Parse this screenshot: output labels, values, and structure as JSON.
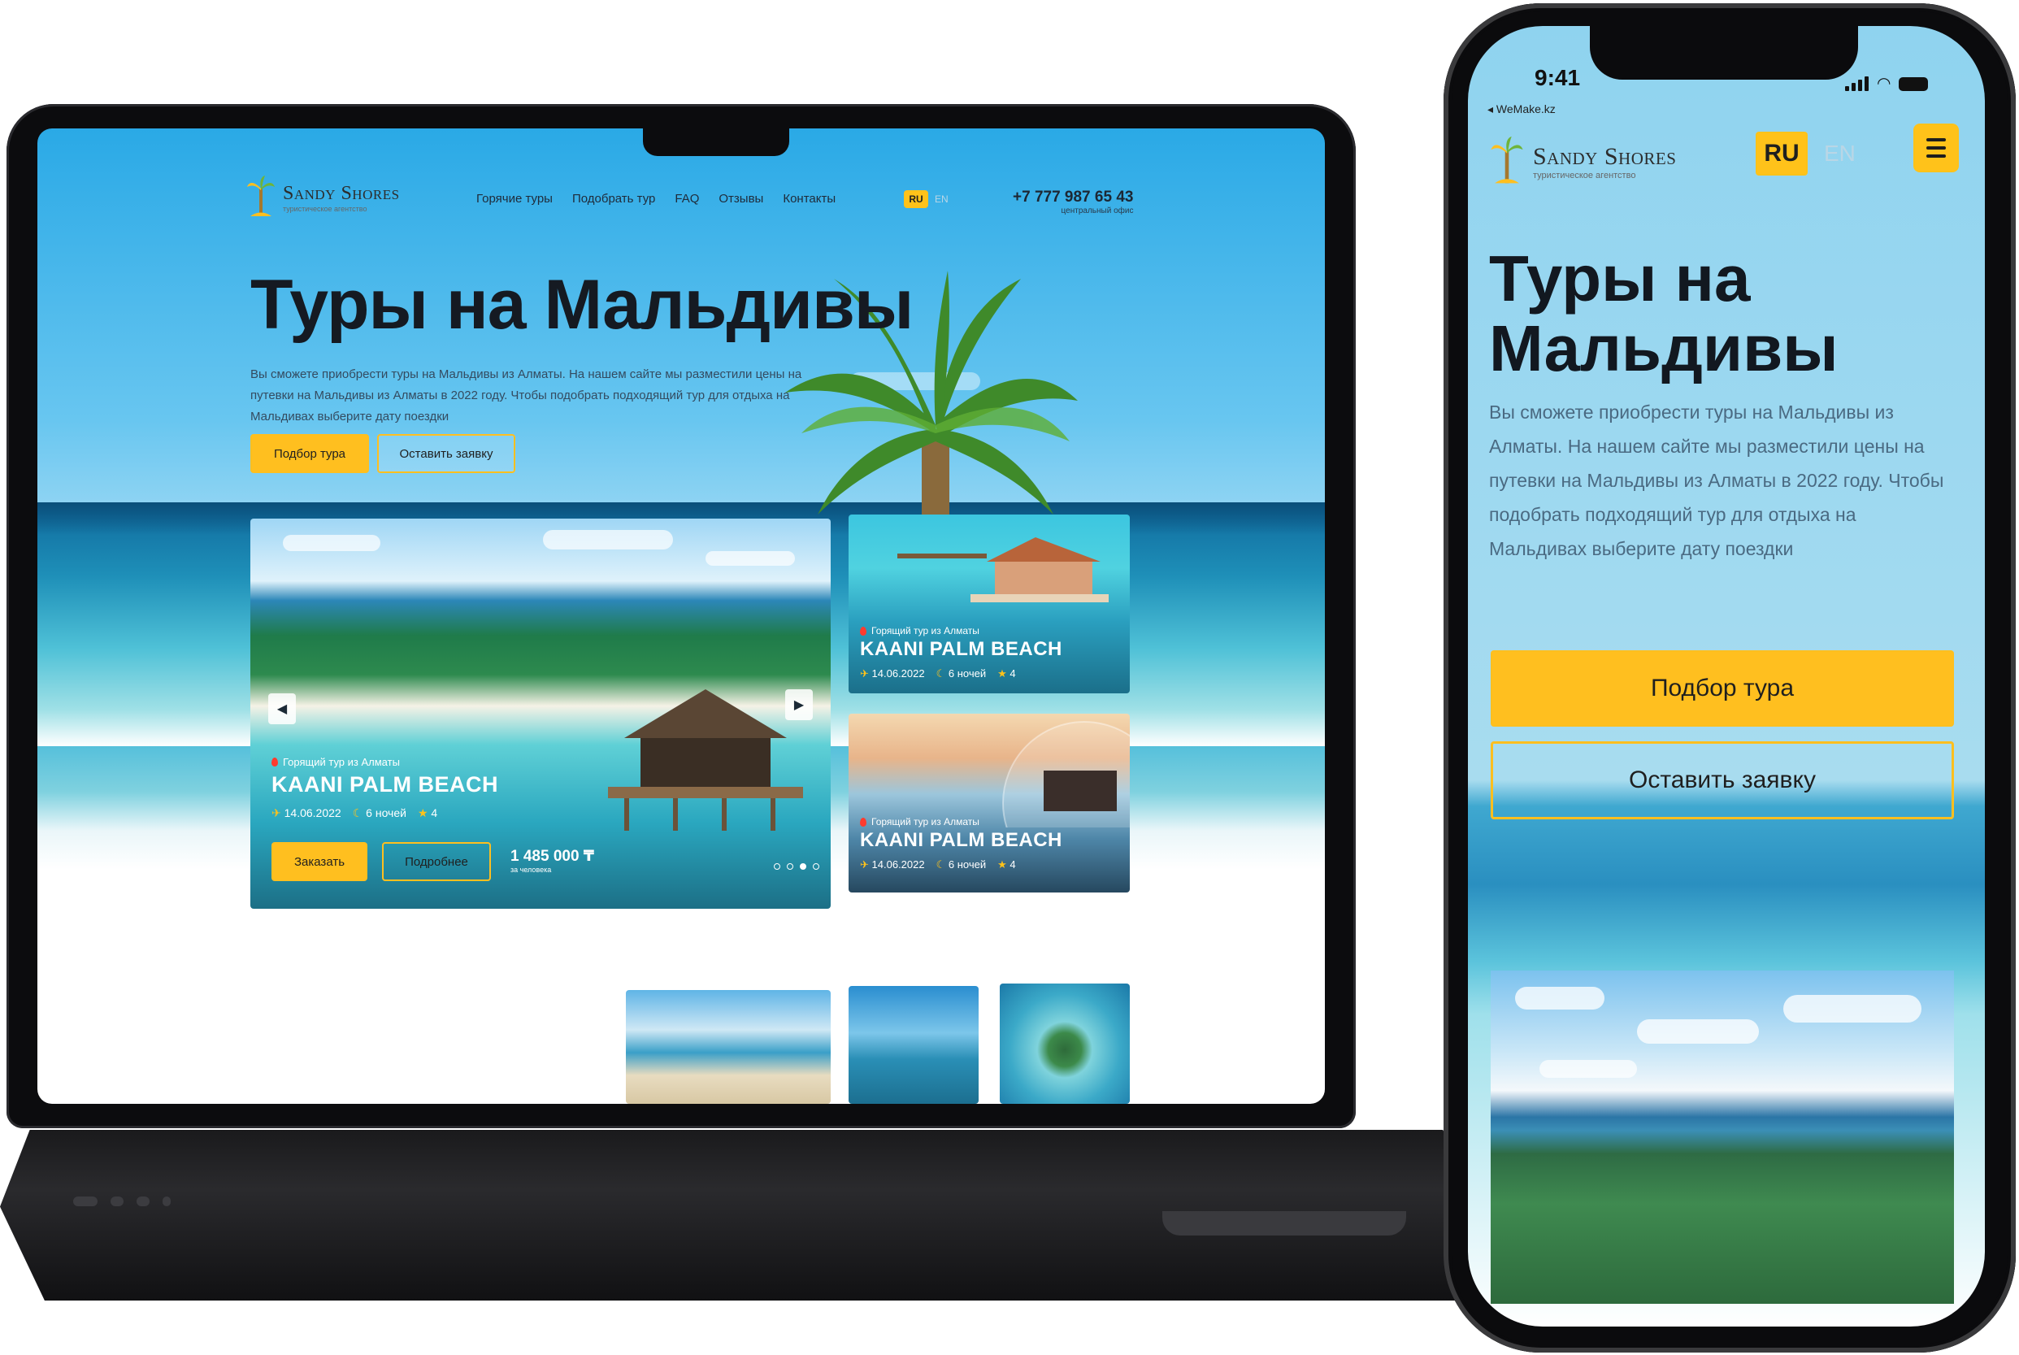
{
  "desktop": {
    "logo": {
      "title": "Sandy Shores",
      "subtitle": "туристическое агентство"
    },
    "nav": [
      "Горячие туры",
      "Подобрать тур",
      "FAQ",
      "Отзывы",
      "Контакты"
    ],
    "lang": {
      "ru": "RU",
      "en": "EN"
    },
    "phone": {
      "number": "+7 777 987 65 43",
      "caption": "центральный офис"
    },
    "hero": {
      "title": "Туры на Мальдивы",
      "description": "Вы сможете приобрести туры на Мальдивы из Алматы. На нашем сайте мы разместили цены на путевки на Мальдивы из Алматы в 2022 году. Чтобы подобрать подходящий тур для отдыха на Мальдивах выберите дату поездки",
      "primary_button": "Подбор тура",
      "secondary_button": "Оставить заявку"
    },
    "main_card": {
      "hot_label": "Горящий тур из Алматы",
      "title": "KAANI PALM BEACH",
      "date": "14.06.2022",
      "nights": "6 ночей",
      "stars": "4",
      "order_button": "Заказать",
      "details_button": "Подробнее",
      "price": "1 485 000 ₸",
      "price_caption": "за человека",
      "prev_arrow": "◀",
      "next_arrow": "▶",
      "active_dot": 3,
      "dot_count": 4
    },
    "side_cards": [
      {
        "hot_label": "Горящий тур из Алматы",
        "title": "KAANI PALM BEACH",
        "date": "14.06.2022",
        "nights": "6 ночей",
        "stars": "4"
      },
      {
        "hot_label": "Горящий тур из Алматы",
        "title": "KAANI PALM BEACH",
        "date": "14.06.2022",
        "nights": "6 ночей",
        "stars": "4"
      }
    ]
  },
  "mobile": {
    "time": "9:41",
    "back_label": "◂ WeMake.kz",
    "logo": {
      "title": "Sandy Shores",
      "subtitle": "туристическое агентство"
    },
    "lang": {
      "ru": "RU",
      "en": "EN"
    },
    "hero": {
      "title": "Туры на Мальдивы",
      "description": "Вы сможете приобрести туры на Мальдивы из Алматы. На нашем сайте мы разместили цены на путевки на Мальдивы из Алматы в 2022 году. Чтобы подобрать подходящий тур для отдыха на Мальдивах выберите дату поездки",
      "primary_button": "Подбор тура",
      "secondary_button": "Оставить заявку"
    }
  },
  "colors": {
    "accent": "#ffbf1f",
    "heading": "#151a22",
    "hot_flame": "#ff3b2e"
  },
  "icons": [
    "palm-logo-icon",
    "plane-icon",
    "moon-icon",
    "star-icon",
    "flame-icon",
    "menu-icon",
    "signal-icon",
    "wifi-icon",
    "battery-icon"
  ]
}
